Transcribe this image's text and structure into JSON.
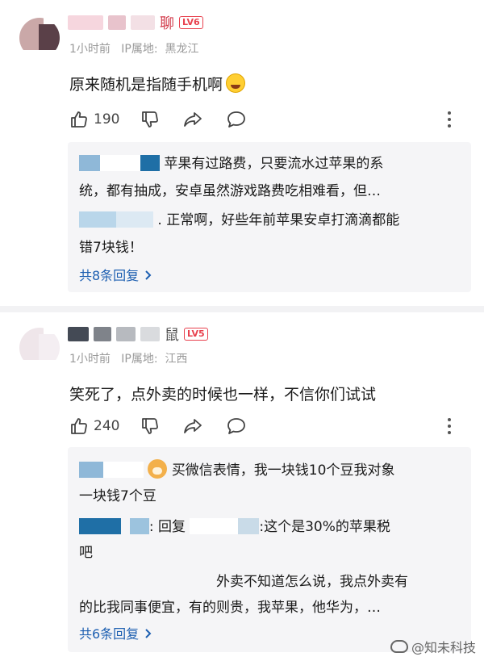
{
  "comments": [
    {
      "username_tail": "聊",
      "level": "LV6",
      "time": "1小时前",
      "ip_prefix": "IP属地:",
      "ip_location": "黑龙江",
      "text": "原来随机是指随手机啊",
      "likes": "190",
      "reply_box": {
        "lines": [
          "苹果有过路费，只要流水过苹果的系",
          "统，都有抽成，安卓虽然游戏路费吃相难看，但…",
          ". 正常啊，好些年前苹果安卓打滴滴都能",
          "错7块钱！"
        ],
        "total": "共8条回复"
      }
    },
    {
      "username_tail": "鼠",
      "level": "LV5",
      "time": "1小时前",
      "ip_prefix": "IP属地:",
      "ip_location": "江西",
      "text": "笑死了，点外卖的时候也一样，不信你们试试",
      "likes": "240",
      "reply_box": {
        "lines": [
          "买微信表情，我一块钱10个豆我对象",
          "一块钱7个豆",
          ": 回复",
          ":这个是30%的苹果税",
          "吧",
          "外卖不知道怎么说，我点外卖有",
          "的比我同事便宜，有的则贵，我苹果，他华为，…"
        ],
        "total": "共6条回复"
      }
    }
  ],
  "watermark": "@知未科技",
  "colors": {
    "level_badge": "#e8414e",
    "link_blue": "#1d5fb1",
    "reply_bg": "#f5f5f7",
    "meta_gray": "#9a9a9a"
  },
  "icons": [
    "thumb-up-icon",
    "thumb-down-icon",
    "share-icon",
    "comment-icon",
    "more-vertical-icon",
    "chevron-right-icon",
    "laugh-cry-emoji-icon",
    "doge-emoji-icon",
    "weibo-icon"
  ]
}
